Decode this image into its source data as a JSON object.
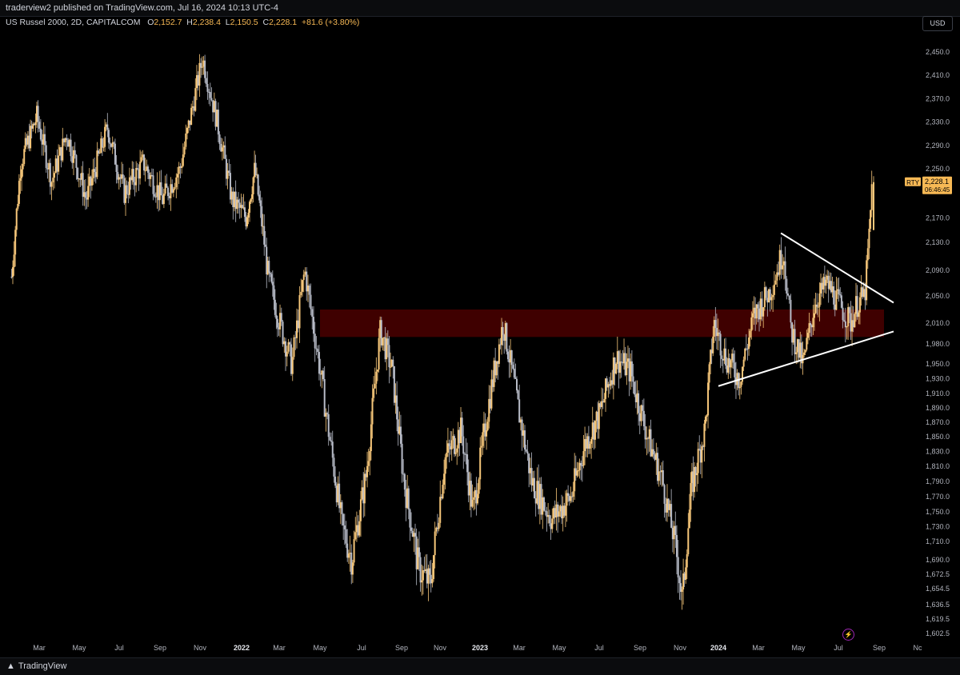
{
  "header": {
    "published": "traderview2 published on TradingView.com, Jul 16, 2024 10:13 UTC-4",
    "symbol": "US Russel 2000, 2D, CAPITALCOM",
    "open_label": "O",
    "open": "2,152.7",
    "high_label": "H",
    "high": "2,238.4",
    "low_label": "L",
    "low": "2,150.5",
    "close_label": "C",
    "close": "2,228.1",
    "change": "+81.6 (+3.80%)",
    "currency_button": "USD"
  },
  "footer": {
    "brand": "TradingView",
    "logo_icon": "tradingview-logo-icon",
    "bolt_icon": "lightning-icon"
  },
  "colors": {
    "background": "#000000",
    "up_candle": "#f7c77a",
    "down_candle": "#b8bcc8",
    "zone": "#4a0000",
    "trendline": "#ffffff",
    "price_tag": "#f7b955"
  },
  "chart_data": {
    "type": "candlestick",
    "symbol": "US Russel 2000",
    "interval": "2D",
    "y_axis_ticks": [
      "2,450.0",
      "2,410.0",
      "2,370.0",
      "2,330.0",
      "2,290.0",
      "2,250.0",
      "2,170.0",
      "2,130.0",
      "2,090.0",
      "2,050.0",
      "2,010.0",
      "1,980.0",
      "1,950.0",
      "1,930.0",
      "1,910.0",
      "1,890.0",
      "1,870.0",
      "1,850.0",
      "1,830.0",
      "1,810.0",
      "1,790.0",
      "1,770.0",
      "1,750.0",
      "1,730.0",
      "1,710.0",
      "1,690.0",
      "1,672.5",
      "1,654.5",
      "1,636.5",
      "1,619.5",
      "1,602.5"
    ],
    "x_axis_ticks": [
      "Mar",
      "May",
      "Jul",
      "Sep",
      "Nov",
      "2022",
      "Mar",
      "May",
      "Jul",
      "Sep",
      "Nov",
      "2023",
      "Mar",
      "May",
      "Jul",
      "Sep",
      "Nov",
      "2024",
      "Mar",
      "May",
      "Jul",
      "Sep",
      "Nc"
    ],
    "bold_x_ticks": [
      "2022",
      "2023",
      "2024"
    ],
    "grid": false,
    "price_path": [
      {
        "t": 2021.05,
        "p": 2080
      },
      {
        "t": 2021.09,
        "p": 2260
      },
      {
        "t": 2021.16,
        "p": 2340
      },
      {
        "t": 2021.22,
        "p": 2230
      },
      {
        "t": 2021.28,
        "p": 2310
      },
      {
        "t": 2021.36,
        "p": 2200
      },
      {
        "t": 2021.45,
        "p": 2320
      },
      {
        "t": 2021.52,
        "p": 2210
      },
      {
        "t": 2021.6,
        "p": 2260
      },
      {
        "t": 2021.68,
        "p": 2200
      },
      {
        "t": 2021.75,
        "p": 2250
      },
      {
        "t": 2021.84,
        "p": 2440
      },
      {
        "t": 2021.9,
        "p": 2330
      },
      {
        "t": 2021.96,
        "p": 2200
      },
      {
        "t": 2022.02,
        "p": 2170
      },
      {
        "t": 2022.06,
        "p": 2250
      },
      {
        "t": 2022.12,
        "p": 2080
      },
      {
        "t": 2022.18,
        "p": 2000
      },
      {
        "t": 2022.22,
        "p": 1950
      },
      {
        "t": 2022.27,
        "p": 2090
      },
      {
        "t": 2022.31,
        "p": 1990
      },
      {
        "t": 2022.36,
        "p": 1870
      },
      {
        "t": 2022.42,
        "p": 1730
      },
      {
        "t": 2022.46,
        "p": 1690
      },
      {
        "t": 2022.52,
        "p": 1800
      },
      {
        "t": 2022.58,
        "p": 2000
      },
      {
        "t": 2022.63,
        "p": 1940
      },
      {
        "t": 2022.68,
        "p": 1790
      },
      {
        "t": 2022.74,
        "p": 1680
      },
      {
        "t": 2022.79,
        "p": 1660
      },
      {
        "t": 2022.85,
        "p": 1820
      },
      {
        "t": 2022.92,
        "p": 1860
      },
      {
        "t": 2022.97,
        "p": 1750
      },
      {
        "t": 2023.04,
        "p": 1900
      },
      {
        "t": 2023.1,
        "p": 2010
      },
      {
        "t": 2023.16,
        "p": 1900
      },
      {
        "t": 2023.22,
        "p": 1790
      },
      {
        "t": 2023.3,
        "p": 1740
      },
      {
        "t": 2023.38,
        "p": 1770
      },
      {
        "t": 2023.44,
        "p": 1840
      },
      {
        "t": 2023.5,
        "p": 1880
      },
      {
        "t": 2023.57,
        "p": 1960
      },
      {
        "t": 2023.63,
        "p": 1940
      },
      {
        "t": 2023.7,
        "p": 1850
      },
      {
        "t": 2023.76,
        "p": 1790
      },
      {
        "t": 2023.82,
        "p": 1690
      },
      {
        "t": 2023.84,
        "p": 1640
      },
      {
        "t": 2023.88,
        "p": 1780
      },
      {
        "t": 2023.94,
        "p": 1860
      },
      {
        "t": 2023.98,
        "p": 2010
      },
      {
        "t": 2024.03,
        "p": 1960
      },
      {
        "t": 2024.09,
        "p": 1930
      },
      {
        "t": 2024.15,
        "p": 2020
      },
      {
        "t": 2024.22,
        "p": 2060
      },
      {
        "t": 2024.27,
        "p": 2120
      },
      {
        "t": 2024.3,
        "p": 2000
      },
      {
        "t": 2024.35,
        "p": 1950
      },
      {
        "t": 2024.4,
        "p": 2040
      },
      {
        "t": 2024.45,
        "p": 2070
      },
      {
        "t": 2024.5,
        "p": 2040
      },
      {
        "t": 2024.55,
        "p": 2010
      },
      {
        "t": 2024.58,
        "p": 2040
      },
      {
        "t": 2024.61,
        "p": 2050
      },
      {
        "t": 2024.63,
        "p": 2150
      },
      {
        "t": 2024.64,
        "p": 2228
      }
    ],
    "annotations": {
      "zone": {
        "from_price": 1990,
        "to_price": 2030,
        "from_t": 2022.33,
        "to_t": 2024.69
      },
      "upper_trendline": [
        {
          "t": 2024.26,
          "p": 2145
        },
        {
          "t": 2024.73,
          "p": 2040
        }
      ],
      "lower_trendline": [
        {
          "t": 2024.0,
          "p": 1920
        },
        {
          "t": 2024.73,
          "p": 1998
        }
      ]
    },
    "last_price": {
      "label": "RTY",
      "price": "2,228.1",
      "countdown": "06:46:45",
      "value": 2228.1
    }
  }
}
